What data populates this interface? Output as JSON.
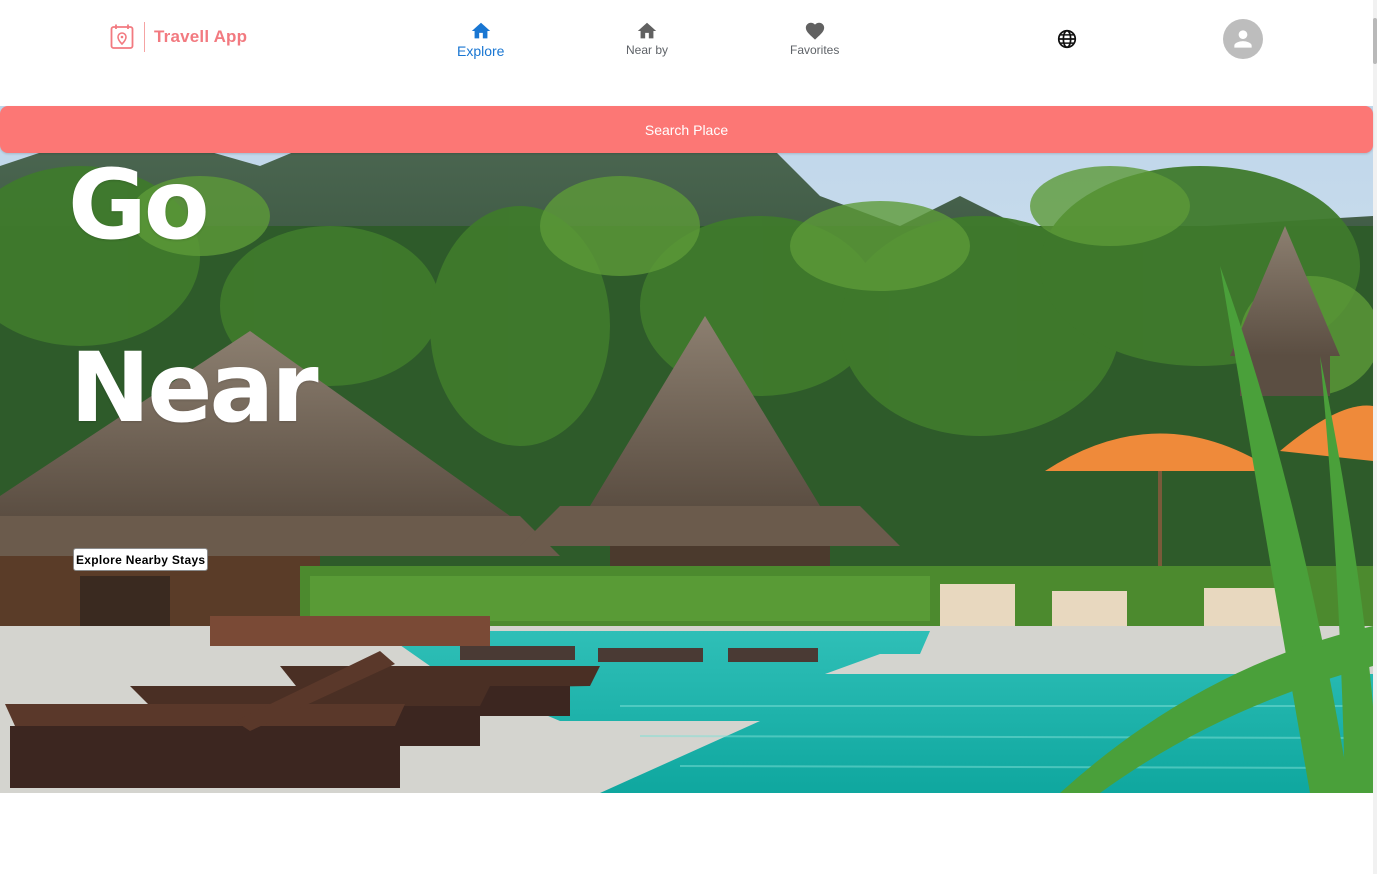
{
  "header": {
    "brand_name": "Travell App",
    "nav": [
      {
        "label": "Explore",
        "icon": "home-icon",
        "active": true
      },
      {
        "label": "Near by",
        "icon": "home-icon",
        "active": false
      },
      {
        "label": "Favorites",
        "icon": "heart-icon",
        "active": false
      }
    ],
    "globe_icon": "globe-icon",
    "avatar_icon": "person-icon"
  },
  "search": {
    "label": "Search Place"
  },
  "hero": {
    "title_line_1": "Go",
    "title_line_2": "Near",
    "cta_label": "Explore Nearby Stays"
  },
  "colors": {
    "brand": "#f27a80",
    "accent": "#fc7775",
    "nav_active": "#1976d2",
    "nav_inactive": "#5f6368",
    "avatar_bg": "#bdbdbd"
  }
}
